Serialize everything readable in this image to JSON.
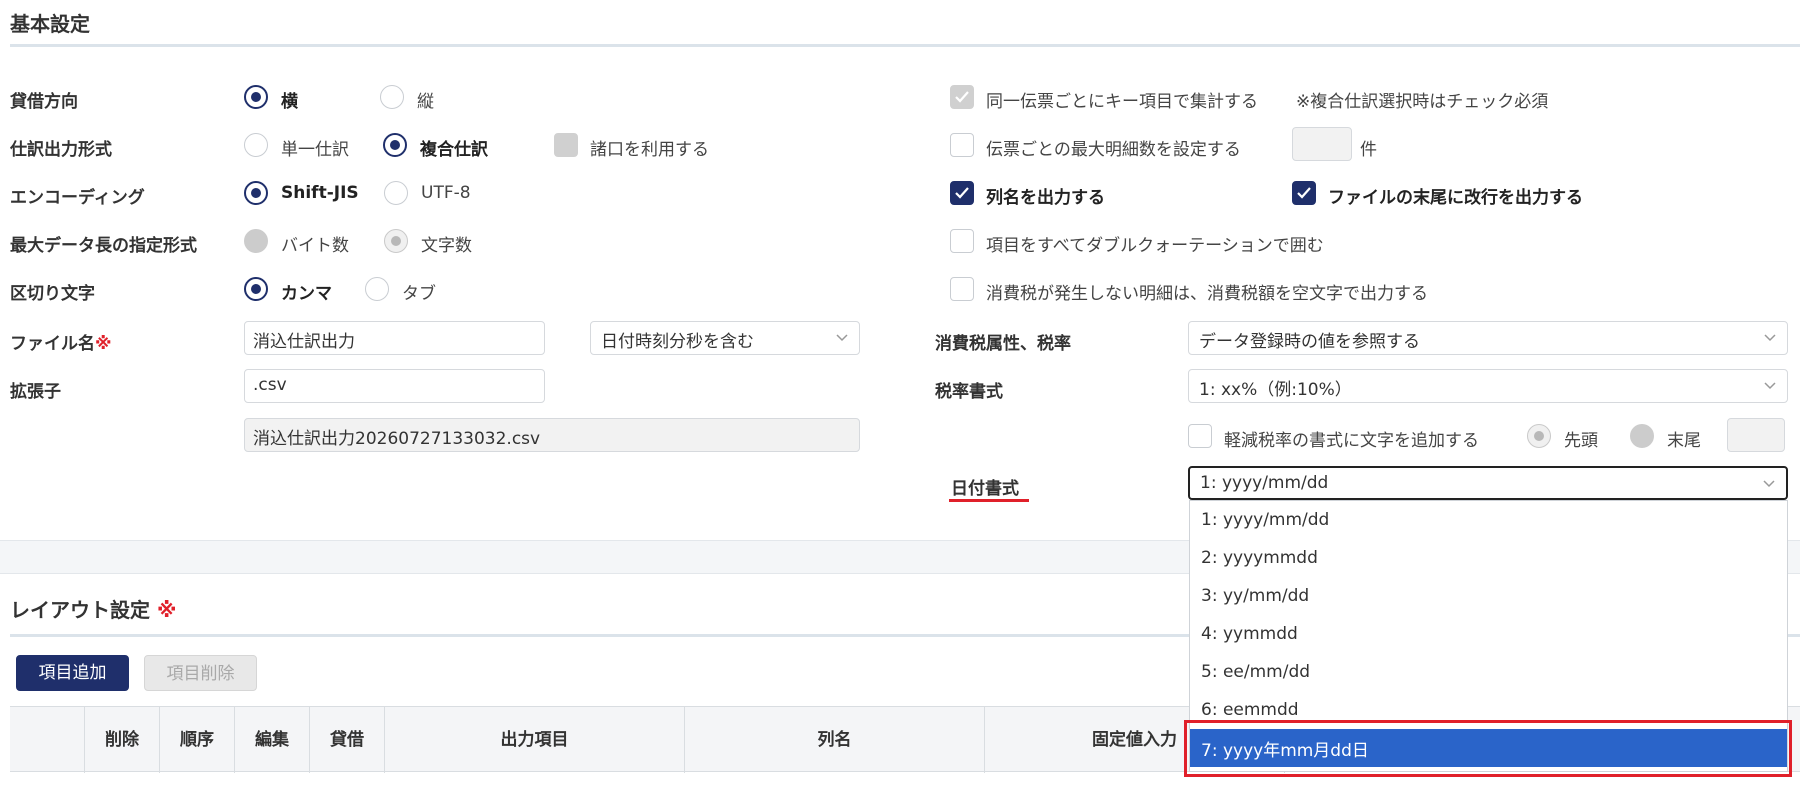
{
  "basic": {
    "title": "基本設定",
    "taishaku": {
      "label": "貸借方向",
      "opt1": "横",
      "opt2": "縦"
    },
    "shiwake": {
      "label": "仕訳出力形式",
      "opt1": "単一仕訳",
      "opt2": "複合仕訳",
      "shoguchi": "諸口を利用する"
    },
    "encoding": {
      "label": "エンコーディング",
      "opt1": "Shift-JIS",
      "opt2": "UTF-8"
    },
    "maxlen": {
      "label": "最大データ長の指定形式",
      "opt1": "バイト数",
      "opt2": "文字数"
    },
    "delimiter": {
      "label": "区切り文字",
      "opt1": "カンマ",
      "opt2": "タブ"
    },
    "filename": {
      "label": "ファイル名",
      "required_mark": "※",
      "value": "消込仕訳出力",
      "suffix_select": "日付時刻分秒を含む"
    },
    "extension": {
      "label": "拡張子",
      "value": ".csv",
      "preview": "消込仕訳出力20260727133032.csv"
    },
    "aggregate": {
      "label": "同一伝票ごとにキー項目で集計する",
      "note": "※複合仕訳選択時はチェック必須"
    },
    "maxdetail": {
      "label": "伝票ごとの最大明細数を設定する",
      "value": "",
      "unit": "件"
    },
    "colname": {
      "label": "列名を出力する"
    },
    "newline": {
      "label": "ファイルの末尾に改行を出力する"
    },
    "quote": {
      "label": "項目をすべてダブルクォーテーションで囲む"
    },
    "taxblank": {
      "label": "消費税が発生しない明細は、消費税額を空文字で出力する"
    },
    "taxattr": {
      "label": "消費税属性、税率",
      "value": "データ登録時の値を参照する"
    },
    "taxrate": {
      "label": "税率書式",
      "value": "1: xx%（例:10%）"
    },
    "reduced": {
      "label": "軽減税率の書式に文字を追加する",
      "opt1": "先頭",
      "opt2": "末尾",
      "value": ""
    },
    "dateformat": {
      "label": "日付書式",
      "value": "1: yyyy/mm/dd",
      "options": [
        "1: yyyy/mm/dd",
        "2: yyyymmdd",
        "3: yy/mm/dd",
        "4: yymmdd",
        "5: ee/mm/dd",
        "6: eemmdd",
        "7: yyyy年mm月dd日"
      ]
    }
  },
  "layout": {
    "title": "レイアウト設定",
    "required_mark": "※",
    "add_button": "項目追加",
    "delete_button": "項目削除",
    "columns": [
      "",
      "削除",
      "順序",
      "編集",
      "貸借",
      "出力項目",
      "列名",
      "固定値入力"
    ]
  },
  "colors": {
    "primary": "#1f2f6b",
    "required": "#e0202a",
    "selected": "#2a64c9"
  }
}
